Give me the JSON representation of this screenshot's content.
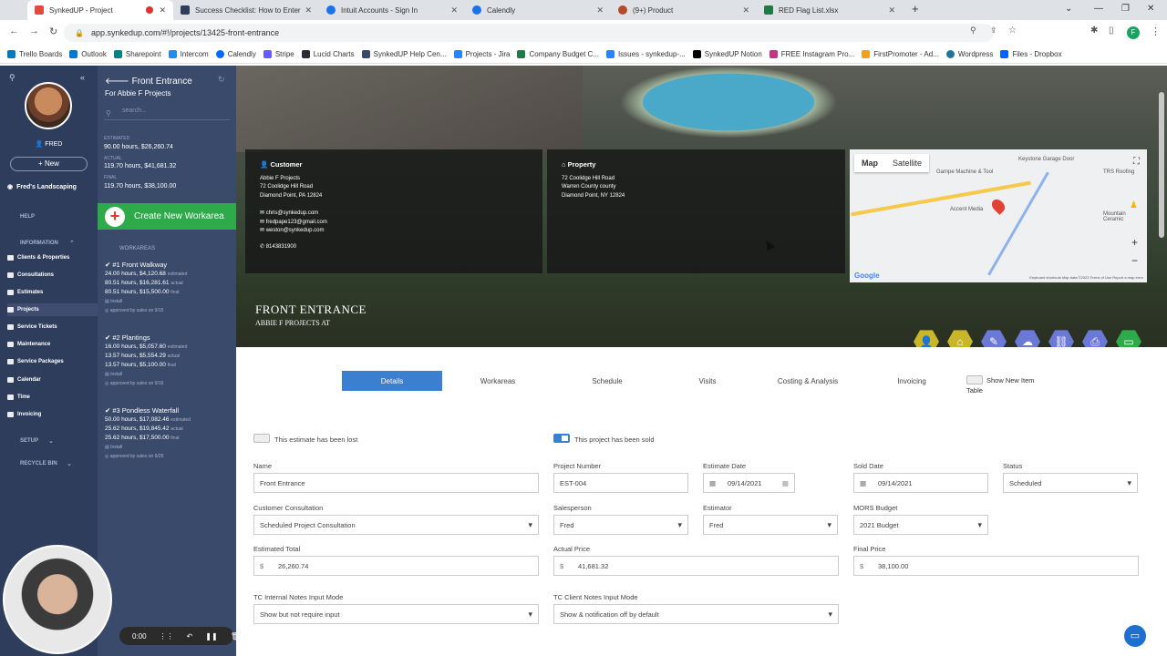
{
  "browser": {
    "tabs": [
      {
        "title": "SynkedUP - Project",
        "active": true,
        "color": "#e24b3b"
      },
      {
        "title": "Success Checklist: How to Enter",
        "active": false,
        "color": "#2f3d5c"
      },
      {
        "title": "Intuit Accounts - Sign In",
        "active": false,
        "color": "#1a73e8"
      },
      {
        "title": "Calendly",
        "active": false,
        "color": "#1a73e8"
      },
      {
        "title": "(9+) Product",
        "active": false,
        "color": "#b54b2b"
      },
      {
        "title": "RED Flag List.xlsx",
        "active": false,
        "color": "#1e7b45"
      }
    ],
    "url": "app.synkedup.com/#!/projects/13425-front-entrance",
    "bookmarks": [
      {
        "label": "Trello Boards",
        "color": "#0079bf"
      },
      {
        "label": "Outlook",
        "color": "#0078d4"
      },
      {
        "label": "Sharepoint",
        "color": "#038387"
      },
      {
        "label": "Intercom",
        "color": "#1f8ded"
      },
      {
        "label": "Calendly",
        "color": "#006bff"
      },
      {
        "label": "Stripe",
        "color": "#635bff"
      },
      {
        "label": "Lucid Charts",
        "color": "#282c33"
      },
      {
        "label": "SynkedUP Help Cen...",
        "color": "#3a4a6b"
      },
      {
        "label": "Projects - Jira",
        "color": "#2684ff"
      },
      {
        "label": "Company Budget C...",
        "color": "#1e7b45"
      },
      {
        "label": "Issues - synkedup-...",
        "color": "#2684ff"
      },
      {
        "label": "SynkedUP Notion",
        "color": "#000000"
      },
      {
        "label": "FREE Instagram Pro...",
        "color": "#c13584"
      },
      {
        "label": "FirstPromoter - Ad...",
        "color": "#f4a018"
      },
      {
        "label": "Wordpress",
        "color": "#21759b"
      },
      {
        "label": "Files - Dropbox",
        "color": "#0061ff"
      }
    ]
  },
  "sidebar": {
    "user": "FRED",
    "new_label": "New",
    "company": "Fred's Landscaping",
    "help": "HELP",
    "information": "INFORMATION",
    "items": [
      "Clients & Properties",
      "Consultations",
      "Estimates",
      "Projects",
      "Service Tickets",
      "Maintenance",
      "Service Packages",
      "Calendar",
      "Time",
      "Invoicing"
    ],
    "setup": "SETUP",
    "recycle": "RECYCLE BIN"
  },
  "project_panel": {
    "title": "Front Entrance",
    "subtitle": "For Abbie F Projects",
    "search_placeholder": "search...",
    "stats": [
      {
        "label": "ESTIMATED",
        "value": "90.00 hours, $26,260.74"
      },
      {
        "label": "ACTUAL",
        "value": "119.70 hours, $41,681.32"
      },
      {
        "label": "FINAL",
        "value": "119.70 hours, $38,100.00"
      }
    ],
    "create_label": "Create New Workarea",
    "workareas_label": "WORKAREAS",
    "workareas": [
      {
        "title": "#1 Front Walkway",
        "est": "24.00 hours, $4,120.68",
        "act": "80.51 hours, $16,281.61",
        "fin": "80.51 hours, $15,500.00",
        "type": "Install",
        "approval": "approved by sales on 9/15"
      },
      {
        "title": "#2 Plantings",
        "est": "16.00 hours, $5,057.60",
        "act": "13.57 hours, $5,554.29",
        "fin": "13.57 hours, $5,100.00",
        "type": "Install",
        "approval": "approved by sales on 9/16"
      },
      {
        "title": "#3 Pondless Waterfall",
        "est": "50.00 hours, $17,082.46",
        "act": "25.62 hours, $19,845.42",
        "fin": "25.62 hours, $17,500.00",
        "type": "Install",
        "approval": "approved by sales on 9/29"
      }
    ],
    "suffix_est": "estimated",
    "suffix_act": "actual",
    "suffix_fin": "final"
  },
  "customer": {
    "heading": "Customer",
    "name": "Abbie F Projects",
    "addr1": "72 Coolidge Hill Road",
    "addr2": "Diamond Point, PA 12824",
    "emails": [
      "chris@synkedup.com",
      "fredpape123@gmail.com",
      "weston@synkedup.com"
    ],
    "phone": "8143831900"
  },
  "property": {
    "heading": "Property",
    "addr1": "72 Coolidge Hill Road",
    "addr2": "Warren County county",
    "addr3": "Diamond Point, NY 12824"
  },
  "map": {
    "tab_map": "Map",
    "tab_sat": "Satellite",
    "place1": "Keystone Garage Door",
    "place2": "Gampe Machine & Tool",
    "place3": "TRS Roofing",
    "place4": "Accent Media",
    "place5": "Mountain Ceramic",
    "footer": "Keyboard shortcuts   Map data ©2023   Terms of Use   Report a map error",
    "logo": "Google"
  },
  "hero": {
    "title": "FRONT ENTRANCE",
    "subtitle": "ABBIE F PROJECTS AT",
    "action_colors": [
      "#c7b52a",
      "#c7b52a",
      "#6a78d6",
      "#6a78d6",
      "#6a78d6",
      "#6a78d6",
      "#2eaa4a"
    ]
  },
  "tabs": [
    "Details",
    "Workareas",
    "Schedule",
    "Visits",
    "Costing & Analysis",
    "Invoicing"
  ],
  "show_new_item": "Show New Item",
  "show_new_item_2": "Table",
  "form": {
    "lost_label": "This estimate has been lost",
    "sold_label": "This project has been sold",
    "name_label": "Name",
    "name_value": "Front Entrance",
    "project_number_label": "Project Number",
    "project_number_value": "EST-004",
    "estimate_date_label": "Estimate Date",
    "estimate_date_value": "09/14/2021",
    "sold_date_label": "Sold Date",
    "sold_date_value": "09/14/2021",
    "status_label": "Status",
    "status_value": "Scheduled",
    "consultation_label": "Customer Consultation",
    "consultation_value": "Scheduled Project Consultation",
    "salesperson_label": "Salesperson",
    "salesperson_value": "Fred",
    "estimator_label": "Estimator",
    "estimator_value": "Fred",
    "mors_label": "MORS Budget",
    "mors_value": "2021 Budget",
    "est_total_label": "Estimated Total",
    "est_total_value": "26,260.74",
    "actual_price_label": "Actual Price",
    "actual_price_value": "41,681.32",
    "final_price_label": "Final Price",
    "final_price_value": "38,100.00",
    "currency": "$",
    "tc_internal_label": "TC Internal Notes Input Mode",
    "tc_internal_value": "Show but not require input",
    "tc_client_label": "TC Client Notes Input Mode",
    "tc_client_value": "Show & notification off by default"
  },
  "player": {
    "time": "0:00"
  }
}
